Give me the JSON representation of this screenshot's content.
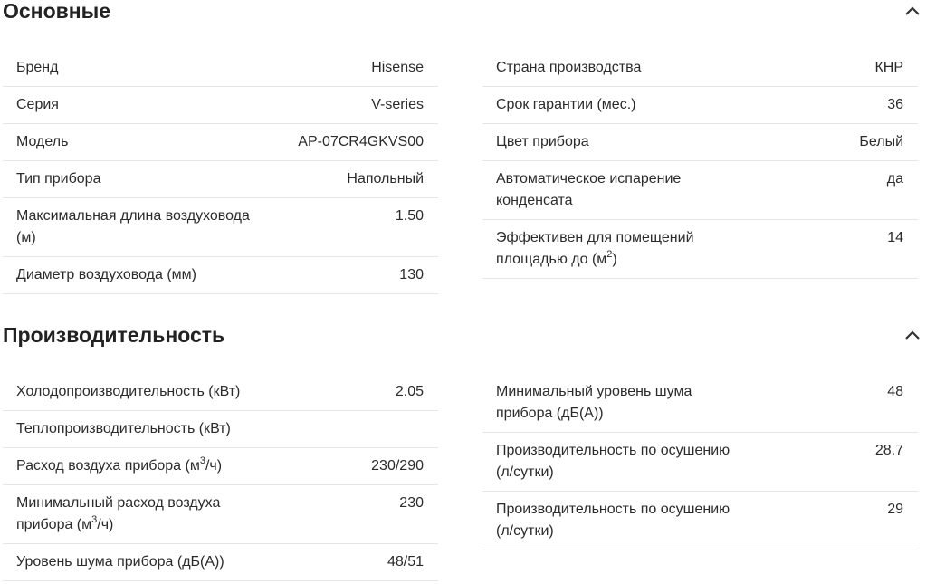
{
  "sections": {
    "main": {
      "title": "Основные",
      "left": [
        {
          "label": "Бренд",
          "value": "Hisense"
        },
        {
          "label": "Серия",
          "value": "V-series"
        },
        {
          "label": "Модель",
          "value": "AP-07CR4GKVS00"
        },
        {
          "label": "Тип прибора",
          "value": "Напольный"
        },
        {
          "label": "Максимальная длина воздуховода (м)",
          "value": "1.50"
        },
        {
          "label": "Диаметр воздуховода (мм)",
          "value": "130"
        }
      ],
      "right": [
        {
          "label": "Страна производства",
          "value": "КНР"
        },
        {
          "label": "Срок гарантии (мес.)",
          "value": "36"
        },
        {
          "label": "Цвет прибора",
          "value": "Белый"
        },
        {
          "label": "Автоматическое испарение конденсата",
          "value": "да"
        },
        {
          "label_pre": "Эффективен для помещений площадью до (м",
          "label_sup": "2",
          "label_post": ")",
          "value": "14"
        }
      ]
    },
    "performance": {
      "title": "Производительность",
      "left": [
        {
          "label": "Холодопроизводительность (кВт)",
          "value": "2.05"
        },
        {
          "label": "Теплопроизводительность (кВт)",
          "value": ""
        },
        {
          "label_pre": "Расход воздуха прибора (м",
          "label_sup": "3",
          "label_post": "/ч)",
          "value": "230/290"
        },
        {
          "label_pre": "Минимальный расход воздуха прибора (м",
          "label_sup": "3",
          "label_post": "/ч)",
          "value": "230"
        },
        {
          "label": "Уровень шума прибора (дБ(А))",
          "value": "48/51"
        }
      ],
      "right": [
        {
          "label": "Минимальный уровень шума прибора (дБ(А))",
          "value": "48"
        },
        {
          "label": "Производительность по осушению (л/сутки)",
          "value": "28.7"
        },
        {
          "label": "Производительность по осушению (л/сутки)",
          "value": "29"
        }
      ]
    }
  },
  "icons": {
    "collapse": "chevron-up-icon"
  }
}
